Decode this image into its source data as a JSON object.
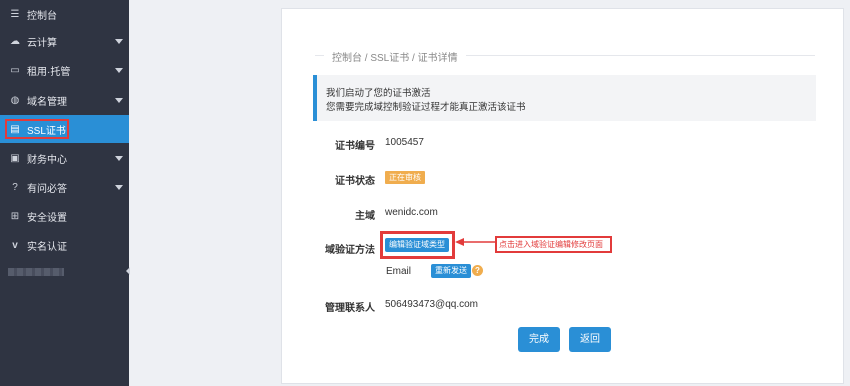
{
  "sidebar": {
    "items": [
      {
        "label": "控制台",
        "icon": "sliders-icon"
      },
      {
        "label": "云计算",
        "icon": "cloud-icon"
      },
      {
        "label": "租用·托管",
        "icon": "monitor-icon"
      },
      {
        "label": "域名管理",
        "icon": "globe-icon"
      },
      {
        "label": "SSL证书",
        "icon": "certificate-icon"
      },
      {
        "label": "财务中心",
        "icon": "chart-icon"
      },
      {
        "label": "有问必答",
        "icon": "question-icon"
      },
      {
        "label": "安全设置",
        "icon": "grid-icon"
      },
      {
        "label": "实名认证",
        "icon": "verify-icon"
      }
    ]
  },
  "breadcrumb": "控制台 / SSL证书 / 证书详情",
  "notice": {
    "line1": "我们启动了您的证书激活",
    "line2": "您需要完成域控制验证过程才能真正激活该证书"
  },
  "fields": {
    "cert_number_label": "证书编号",
    "cert_number": "1005457",
    "cert_status_label": "证书状态",
    "cert_status": "正在审核",
    "domain_label": "主域",
    "domain": "wenidc.com",
    "verify_method_label": "域验证方法",
    "edit_verify_button": "编辑验证域类型",
    "email_label": "Email",
    "resend_button": "重新发送",
    "contact_label": "管理联系人",
    "contact": "506493473@qq.com"
  },
  "annotation": "点击进入域验证编辑修改页面",
  "actions": {
    "done": "完成",
    "back": "返回"
  },
  "colors": {
    "sidebar_bg": "#2f3442",
    "accent": "#2a8fd6",
    "warning": "#f0ad4e",
    "highlight": "#e23b3b"
  }
}
